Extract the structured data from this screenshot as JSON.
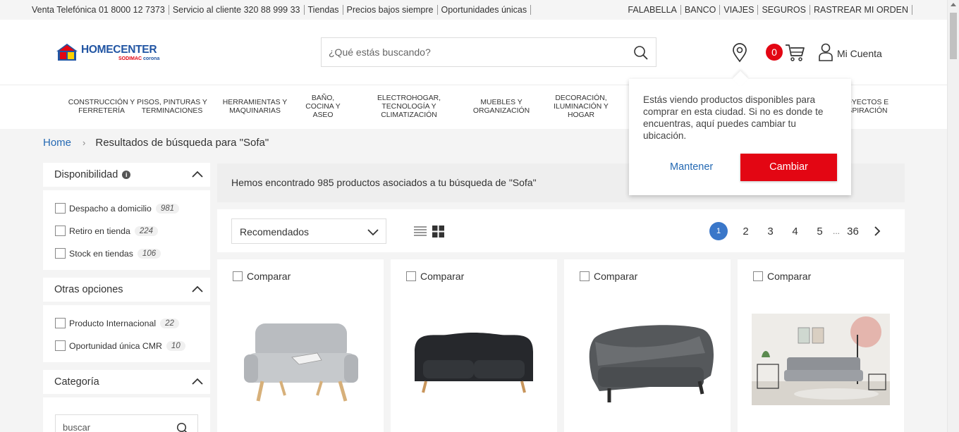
{
  "topbar": {
    "left": [
      "Venta Telefónica 01 8000 12 7373",
      "Servicio al cliente 320 88 999 33",
      "Tiendas",
      "Precios bajos siempre",
      "Oportunidades únicas"
    ],
    "right": [
      "FALABELLA",
      "BANCO",
      "VIAJES",
      "SEGUROS",
      "RASTREAR MI ORDEN"
    ]
  },
  "header": {
    "logo_text": "HOMECENTER",
    "logo_sub_left": "SODIMAC",
    "logo_sub_right": "corona",
    "search_placeholder": "¿Qué estás buscando?",
    "cart_count": "0",
    "account_label": "Mi Cuenta"
  },
  "categories": [
    "CONSTRUCCIÓN Y FERRETERÍA",
    "PISOS, PINTURAS Y TERMINACIONES",
    "HERRAMIENTAS Y MAQUINARIAS",
    "BAÑO, COCINA Y ASEO",
    "ELECTROHOGAR, TECNOLOGÍA Y CLIMATIZACIÓN",
    "MUEBLES Y ORGANIZACIÓN",
    "DECORACIÓN, ILUMINACIÓN Y HOGAR",
    "OYECTOS E SPIRACIÓN"
  ],
  "breadcrumb": {
    "home": "Home",
    "current": "Resultados de búsqueda para \"Sofa\""
  },
  "filters": {
    "disponibilidad": {
      "title": "Disponibilidad",
      "options": [
        {
          "label": "Despacho a domicilio",
          "count": "981"
        },
        {
          "label": "Retiro en tienda",
          "count": "224"
        },
        {
          "label": "Stock en tiendas",
          "count": "106"
        }
      ]
    },
    "otras": {
      "title": "Otras opciones",
      "options": [
        {
          "label": "Producto Internacional",
          "count": "22"
        },
        {
          "label": "Oportunidad única CMR",
          "count": "10"
        }
      ]
    },
    "categoria": {
      "title": "Categoría",
      "search_placeholder": "buscar"
    }
  },
  "results": {
    "summary": "Hemos encontrado 985 productos asociados a tu búsqueda de \"Sofa\"",
    "sort_value": "Recomendados",
    "pages": [
      "1",
      "2",
      "3",
      "4",
      "5",
      "36"
    ],
    "ellipsis": "...",
    "compare_label": "Comparar"
  },
  "popup": {
    "message": "Estás viendo productos disponibles para comprar en esta ciudad. Si no es donde te encuentras, aquí puedes cambiar tu ubicación.",
    "keep_label": "Mantener",
    "change_label": "Cambiar"
  },
  "colors": {
    "brand_blue": "#2155a3",
    "brand_red": "#e30613",
    "link_blue": "#2469b3",
    "page_active": "#3a77c9"
  }
}
